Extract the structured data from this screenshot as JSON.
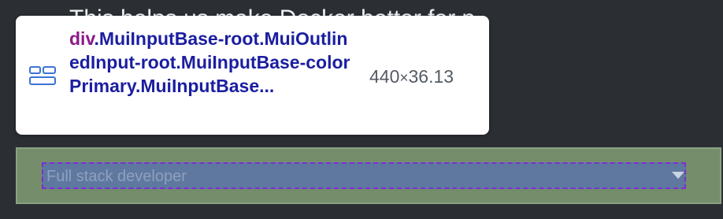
{
  "background": {
    "heading_text": "This helps us make Docker better for p"
  },
  "select": {
    "placeholder": "Full stack developer"
  },
  "tooltip": {
    "icon": "flex-layout-icon",
    "tag": "div",
    "classes": ".MuiInputBase-root.MuiOutlinedInput-root.MuiInputBase-colorPrimary.MuiInputBase...",
    "dims_width": "440",
    "dims_sep": "×",
    "dims_height": "36.13"
  },
  "colors": {
    "page_bg": "#2b2f33",
    "margin_overlay": "#758d6b",
    "content_overlay": "#5f78a0",
    "tag_color": "#8b1a8b",
    "class_color": "#1b1ea0",
    "dashed_outline": "#7d2fd0"
  }
}
